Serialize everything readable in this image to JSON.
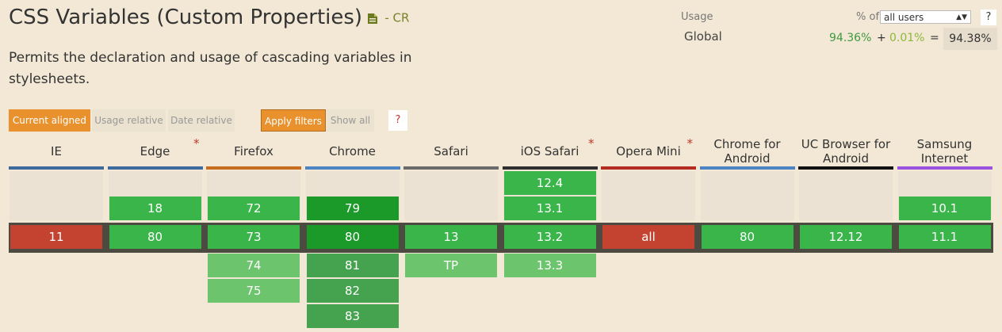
{
  "title": "CSS Variables (Custom Properties)",
  "status": "- CR",
  "description": "Permits the declaration and usage of cascading variables in stylesheets.",
  "usage": {
    "label": "Usage",
    "region": "Global",
    "pct_of_label": "% of",
    "users_select": "all users",
    "help": "?",
    "full_support": "94.36%",
    "plus": "+",
    "partial_support": "0.01%",
    "equals": "=",
    "total": "94.38%"
  },
  "filters": {
    "current_aligned": "Current aligned",
    "usage_relative": "Usage relative",
    "date_relative": "Date relative",
    "apply_filters": "Apply filters",
    "show_all": "Show all",
    "help": "?"
  },
  "colors": {
    "background": "#f2e8d5",
    "supported": "#39b54a",
    "supported_current": "#1b9a2a",
    "not_supported": "#c44230",
    "future": "#6cc46d",
    "accent": "#e8912d"
  },
  "browsers": [
    {
      "name": "IE",
      "note": "",
      "bar": "#3d6a9c",
      "past": [],
      "current": {
        "v": "11",
        "s": "n"
      },
      "future": []
    },
    {
      "name": "Edge",
      "note": "*",
      "bar": "#3d6a9c",
      "past": [
        {
          "v": "18",
          "s": "y"
        }
      ],
      "current": {
        "v": "80",
        "s": "y"
      },
      "future": []
    },
    {
      "name": "Firefox",
      "note": "",
      "bar": "#c66d22",
      "past": [
        {
          "v": "72",
          "s": "y"
        }
      ],
      "current": {
        "v": "73",
        "s": "y"
      },
      "future": [
        {
          "v": "74",
          "s": "fut"
        },
        {
          "v": "75",
          "s": "fut"
        }
      ]
    },
    {
      "name": "Chrome",
      "note": "",
      "bar": "#4c83c2",
      "past": [
        {
          "v": "79",
          "s": "y-cur"
        }
      ],
      "current": {
        "v": "80",
        "s": "y-cur"
      },
      "future": [
        {
          "v": "81",
          "s": "fut-dark"
        },
        {
          "v": "82",
          "s": "fut-dark"
        },
        {
          "v": "83",
          "s": "fut-dark"
        }
      ]
    },
    {
      "name": "Safari",
      "note": "",
      "bar": "#6b6b6b",
      "past": [],
      "current": {
        "v": "13",
        "s": "y"
      },
      "future": [
        {
          "v": "TP",
          "s": "fut"
        }
      ]
    },
    {
      "name": "iOS Safari",
      "note": "*",
      "bar": "#2f2f2f",
      "past": [
        {
          "v": "12.4",
          "s": "y"
        },
        {
          "v": "13.1",
          "s": "y"
        }
      ],
      "current": {
        "v": "13.2",
        "s": "y"
      },
      "future": [
        {
          "v": "13.3",
          "s": "fut"
        }
      ]
    },
    {
      "name": "Opera Mini",
      "note": "*",
      "bar": "#b22c22",
      "past": [],
      "current": {
        "v": "all",
        "s": "n"
      },
      "future": []
    },
    {
      "name": "Chrome for Android",
      "note": "",
      "bar": "#4c83c2",
      "past": [],
      "current": {
        "v": "80",
        "s": "y"
      },
      "future": []
    },
    {
      "name": "UC Browser for Android",
      "note": "",
      "bar": "#111111",
      "past": [],
      "current": {
        "v": "12.12",
        "s": "y"
      },
      "future": []
    },
    {
      "name": "Samsung Internet",
      "note": "",
      "bar": "#9a52e0",
      "past": [
        {
          "v": "10.1",
          "s": "y"
        }
      ],
      "current": {
        "v": "11.1",
        "s": "y"
      },
      "future": []
    }
  ]
}
